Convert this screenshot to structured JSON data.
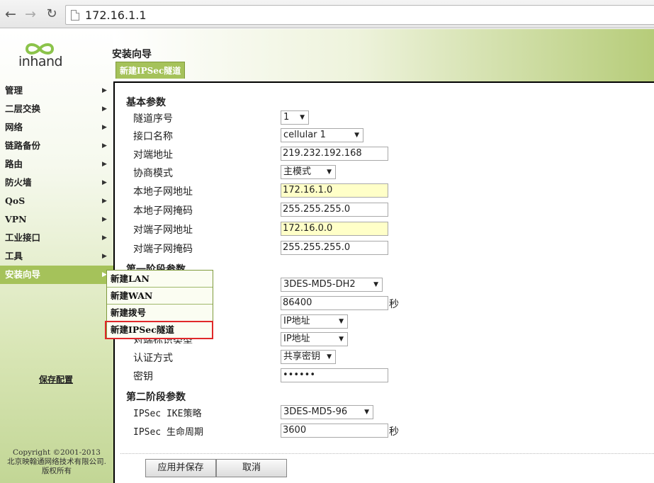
{
  "browser": {
    "url": "172.16.1.1"
  },
  "logo": {
    "text": "inhand"
  },
  "sidebar": {
    "items": [
      {
        "label": "管理"
      },
      {
        "label": "二层交换"
      },
      {
        "label": "网络"
      },
      {
        "label": "链路备份"
      },
      {
        "label": "路由"
      },
      {
        "label": "防火墙"
      },
      {
        "label": "QoS"
      },
      {
        "label": "VPN"
      },
      {
        "label": "工业接口"
      },
      {
        "label": "工具"
      },
      {
        "label": "安装向导",
        "active": true
      }
    ],
    "arrow_glyph": "▶",
    "save_config": "保存配置",
    "copyright": [
      "Copyright ©2001-2013",
      "北京映翰通网络技术有限公司.",
      "版权所有"
    ]
  },
  "header": {
    "title": "安装向导",
    "tab": "新建IPSec隧道"
  },
  "flyout": {
    "items": [
      "新建LAN",
      "新建WAN",
      "新建拨号",
      "新建IPSec隧道"
    ],
    "highlighted_index": 3
  },
  "form": {
    "basic": {
      "title": "基本参数",
      "tunnel_index": {
        "label": "隧道序号",
        "value": "1"
      },
      "interface": {
        "label": "接口名称",
        "value": "cellular 1"
      },
      "peer_address": {
        "label": "对端地址",
        "value": "219.232.192.168"
      },
      "negotiation_mode": {
        "label": "协商模式",
        "value": "主模式"
      },
      "local_subnet": {
        "label": "本地子网地址",
        "value": "172.16.1.0"
      },
      "local_mask": {
        "label": "本地子网掩码",
        "value": "255.255.255.0"
      },
      "remote_subnet": {
        "label": "对端子网地址",
        "value": "172.16.0.0"
      },
      "remote_mask": {
        "label": "对端子网掩码",
        "value": "255.255.255.0"
      }
    },
    "phase1": {
      "title": "第一阶段参数",
      "ike_policy": {
        "value": "3DES-MD5-DH2"
      },
      "ike_lifetime": {
        "value": "86400",
        "unit": "秒"
      },
      "local_id_type": {
        "value": "IP地址"
      },
      "remote_id_type": {
        "label": "对端标识类型",
        "value": "IP地址"
      },
      "auth_method": {
        "label": "认证方式",
        "value": "共享密钥"
      },
      "key": {
        "label": "密钥",
        "value": "••••••"
      }
    },
    "phase2": {
      "title": "第二阶段参数",
      "ipsec_policy": {
        "label": "IPSec IKE策略",
        "value": "3DES-MD5-96"
      },
      "ipsec_lifetime": {
        "label": "IPSec 生命周期",
        "value": "3600",
        "unit": "秒"
      }
    },
    "buttons": {
      "apply": "应用并保存",
      "cancel": "取消"
    }
  },
  "colors": {
    "accent": "#a5c25a",
    "highlight_border": "#e0282a",
    "input_highlight": "#ffffc8"
  }
}
